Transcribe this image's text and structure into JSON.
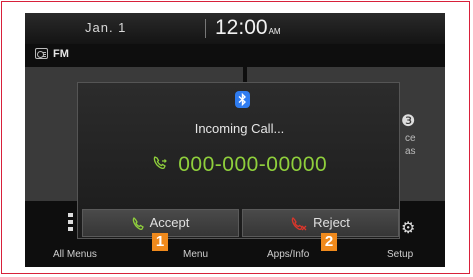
{
  "status_bar": {
    "date": "Jan.  1",
    "time": "12:00",
    "ampm": "AM"
  },
  "background": {
    "source": "FM",
    "right_tile_fragment_1": "ce",
    "right_tile_fragment_2": "as",
    "bottom_menu": [
      "All Menus",
      "Menu",
      "Apps/Info",
      "Setup"
    ]
  },
  "dialog": {
    "title": "Incoming Call...",
    "number": "000-000-00000",
    "accept_label": "Accept",
    "reject_label": "Reject"
  },
  "callouts": [
    "1",
    "2"
  ],
  "colors": {
    "accent_green": "#8fcf3c",
    "reject_red": "#d9362b",
    "bluetooth_blue": "#2f7cf0",
    "callout_orange": "#f08a1c",
    "frame_border": "#d8203a"
  },
  "icons": [
    "radio-icon",
    "bluetooth-icon",
    "incoming-call-icon",
    "accept-phone-icon",
    "reject-phone-icon",
    "menu-dots-icon",
    "gear-icon"
  ]
}
